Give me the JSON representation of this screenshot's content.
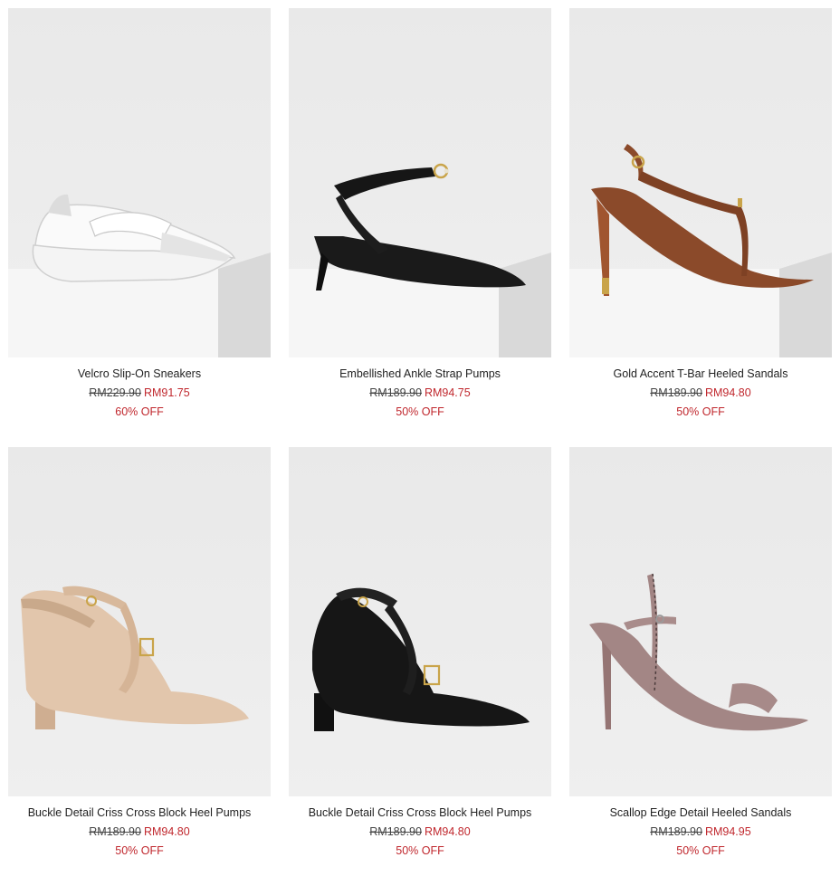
{
  "products": [
    {
      "name": "Velcro Slip-On Sneakers",
      "old_price": "RM229.90",
      "new_price": "RM91.75",
      "discount": "60% OFF",
      "image": "white-sneaker"
    },
    {
      "name": "Embellished Ankle Strap Pumps",
      "old_price": "RM189.90",
      "new_price": "RM94.75",
      "discount": "50% OFF",
      "image": "black-ankle-strap-pump"
    },
    {
      "name": "Gold Accent T-Bar Heeled Sandals",
      "old_price": "RM189.90",
      "new_price": "RM94.80",
      "discount": "50% OFF",
      "image": "brown-t-bar-sandal"
    },
    {
      "name": "Buckle Detail Criss Cross Block Heel Pumps",
      "old_price": "RM189.90",
      "new_price": "RM94.80",
      "discount": "50% OFF",
      "image": "nude-block-heel-pump"
    },
    {
      "name": "Buckle Detail Criss Cross Block Heel Pumps",
      "old_price": "RM189.90",
      "new_price": "RM94.80",
      "discount": "50% OFF",
      "image": "black-block-heel-pump"
    },
    {
      "name": "Scallop Edge Detail Heeled Sandals",
      "old_price": "RM189.90",
      "new_price": "RM94.95",
      "discount": "50% OFF",
      "image": "mauve-heeled-sandal"
    }
  ],
  "colors": {
    "sale": "#c0272d",
    "text": "#222222",
    "photo_bg": "#ebebeb"
  }
}
